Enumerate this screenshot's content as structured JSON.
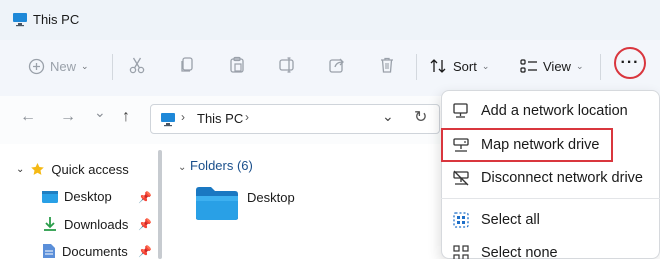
{
  "window": {
    "title": "This PC"
  },
  "toolbar": {
    "new_label": "New",
    "sort_label": "Sort",
    "view_label": "View",
    "more_label": "···",
    "icons": [
      "cut-icon",
      "copy-icon",
      "paste-icon",
      "rename-icon",
      "share-icon",
      "delete-icon"
    ]
  },
  "nav": {
    "back": "←",
    "forward": "→",
    "recent": "⌄",
    "up": "↑",
    "address": "This PC",
    "refresh": "↻",
    "address_dropdown": "⌄"
  },
  "sidebar": {
    "quick_access_label": "Quick access",
    "items": [
      {
        "label": "Desktop",
        "icon": "desktop-folder-icon",
        "pinned": true
      },
      {
        "label": "Downloads",
        "icon": "download-icon",
        "pinned": true
      },
      {
        "label": "Documents",
        "icon": "documents-icon",
        "pinned": true
      }
    ]
  },
  "content": {
    "group_label": "Folders (6)",
    "folders": [
      {
        "label": "Desktop"
      }
    ]
  },
  "menu": {
    "items": [
      {
        "label": "Add a network location",
        "icon": "network-location-icon"
      },
      {
        "label": "Map network drive",
        "icon": "map-drive-icon",
        "highlighted": true
      },
      {
        "label": "Disconnect network drive",
        "icon": "disconnect-drive-icon"
      },
      {
        "label": "Select all",
        "icon": "select-all-icon"
      },
      {
        "label": "Select none",
        "icon": "select-none-icon"
      }
    ]
  },
  "colors": {
    "accent": "#0067c0",
    "highlight": "#d9363e",
    "toolbar_bg": "#f3f6fb"
  }
}
